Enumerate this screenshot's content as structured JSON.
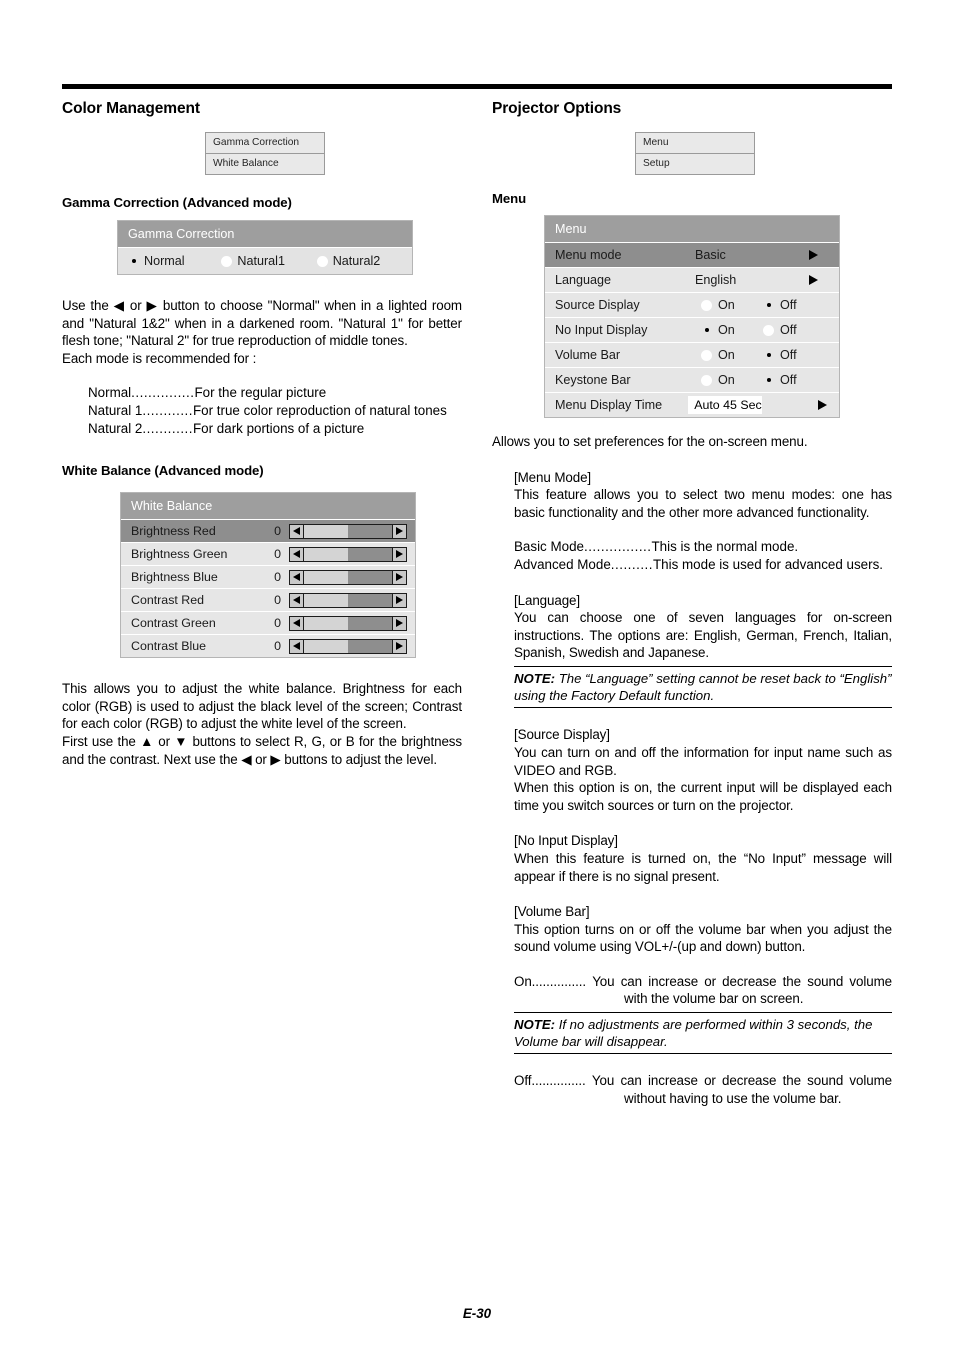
{
  "page": {
    "footer_label": "E-30"
  },
  "left_column": {
    "section_title": "Color Management",
    "nav_box": {
      "items": [
        "Gamma Correction",
        "White Balance"
      ]
    },
    "gamma": {
      "sub_title": "Gamma Correction (Advanced mode)",
      "panel_header": "Gamma Correction",
      "options": [
        {
          "label": "Normal",
          "selected": true
        },
        {
          "label": "Natural1",
          "selected": false
        },
        {
          "label": "Natural2",
          "selected": false
        }
      ],
      "paragraph": "Use the ◀ or ▶ button to choose \"Normal\" when in a lighted room and \"Natural 1&2\" when in a darkened room. \"Natural 1\" for better flesh tone; \"Natural 2\" for true reproduction of middle tones.",
      "paragraph2": "Each mode is recommended for :",
      "modes": [
        {
          "name": "Normal",
          "leader": "...............",
          "desc": "For the regular picture"
        },
        {
          "name": "Natural 1",
          "leader": "............",
          "desc": "For true color reproduction of natural tones"
        },
        {
          "name": "Natural 2",
          "leader": "............",
          "desc": "For dark portions of a picture"
        }
      ]
    },
    "white_balance": {
      "sub_title": "White Balance (Advanced mode)",
      "panel_header": "White Balance",
      "rows": [
        {
          "label": "Brightness Red",
          "value": "0",
          "fill_pct": 50,
          "selected": true
        },
        {
          "label": "Brightness Green",
          "value": "0",
          "fill_pct": 50,
          "selected": false
        },
        {
          "label": "Brightness Blue",
          "value": "0",
          "fill_pct": 50,
          "selected": false
        },
        {
          "label": "Contrast Red",
          "value": "0",
          "fill_pct": 50,
          "selected": false
        },
        {
          "label": "Contrast Green",
          "value": "0",
          "fill_pct": 50,
          "selected": false
        },
        {
          "label": "Contrast Blue",
          "value": "0",
          "fill_pct": 50,
          "selected": false
        }
      ],
      "paragraph": "This allows you to adjust the white balance. Brightness for each color (RGB) is used to adjust the black level of the screen; Contrast for each color (RGB) to adjust the white level of the screen.",
      "paragraph2": "First use the ▲ or ▼ buttons to select R, G, or B for the brightness and the contrast. Next use the ◀ or ▶ buttons to adjust the level."
    }
  },
  "right_column": {
    "section_title": "Projector Options",
    "nav_box": {
      "items": [
        "Menu",
        "Setup"
      ]
    },
    "menu": {
      "sub_title": "Menu",
      "panel_header": "Menu",
      "rows": [
        {
          "label": "Menu mode",
          "type": "arrow",
          "value": "Basic",
          "selected": true
        },
        {
          "label": "Language",
          "type": "arrow",
          "value": "English",
          "selected": false
        },
        {
          "label": "Source Display",
          "type": "onoff",
          "on_label": "On",
          "off_label": "Off",
          "state": "Off",
          "selected": false
        },
        {
          "label": "No Input Display",
          "type": "onoff",
          "on_label": "On",
          "off_label": "Off",
          "state": "On",
          "selected": false
        },
        {
          "label": "Volume Bar",
          "type": "onoff",
          "on_label": "On",
          "off_label": "Off",
          "state": "Off",
          "selected": false
        },
        {
          "label": "Keystone Bar",
          "type": "onoff",
          "on_label": "On",
          "off_label": "Off",
          "state": "Off",
          "selected": false
        },
        {
          "label": "Menu Display Time",
          "type": "input",
          "value": "Auto 45 Sec",
          "selected": false
        }
      ],
      "intro": "Allows you to set preferences for the on-screen menu.",
      "menu_mode": {
        "heading": "[Menu Mode]",
        "body": "This feature allows you to select two menu modes: one has basic functionality and the other more advanced functionality.",
        "modes": [
          {
            "name": "Basic Mode",
            "leader": "................",
            "desc": "This is the normal mode."
          },
          {
            "name": "Advanced Mode",
            "leader": "..........",
            "desc": "This mode is used for advanced users."
          }
        ]
      },
      "language": {
        "heading": "[Language]",
        "body": "You can choose one of seven languages for on-screen instructions. The options are: English, German, French, Italian, Spanish, Swedish and Japanese.",
        "note_label": "NOTE:",
        "note_body": " The “Language” setting cannot be reset back to “English” using the Factory Default function."
      },
      "source_display": {
        "heading": "[Source Display]",
        "body": "You can turn on and off the information for input name such as VIDEO and RGB.",
        "body2": "When this option is on, the current input will be displayed each time you switch sources or turn on the projector."
      },
      "no_input_display": {
        "heading": "[No Input Display]",
        "body": "When this feature is turned on, the “No Input” message will appear if there is no signal present."
      },
      "volume_bar": {
        "heading": "[Volume Bar]",
        "body": "This option turns on or off the volume bar when you adjust the sound volume using VOL+/-(up and down) button.",
        "on_name": "On",
        "on_leader": "...............",
        "on_desc": "You can increase or decrease the sound volume with the volume bar on screen.",
        "note_label": "NOTE:",
        "note_body": " If no adjustments are performed within 3 seconds, the Volume bar will disappear.",
        "off_name": "Off",
        "off_leader": "...............",
        "off_desc": "You can increase or decrease the sound volume without having to use the volume bar."
      }
    }
  }
}
